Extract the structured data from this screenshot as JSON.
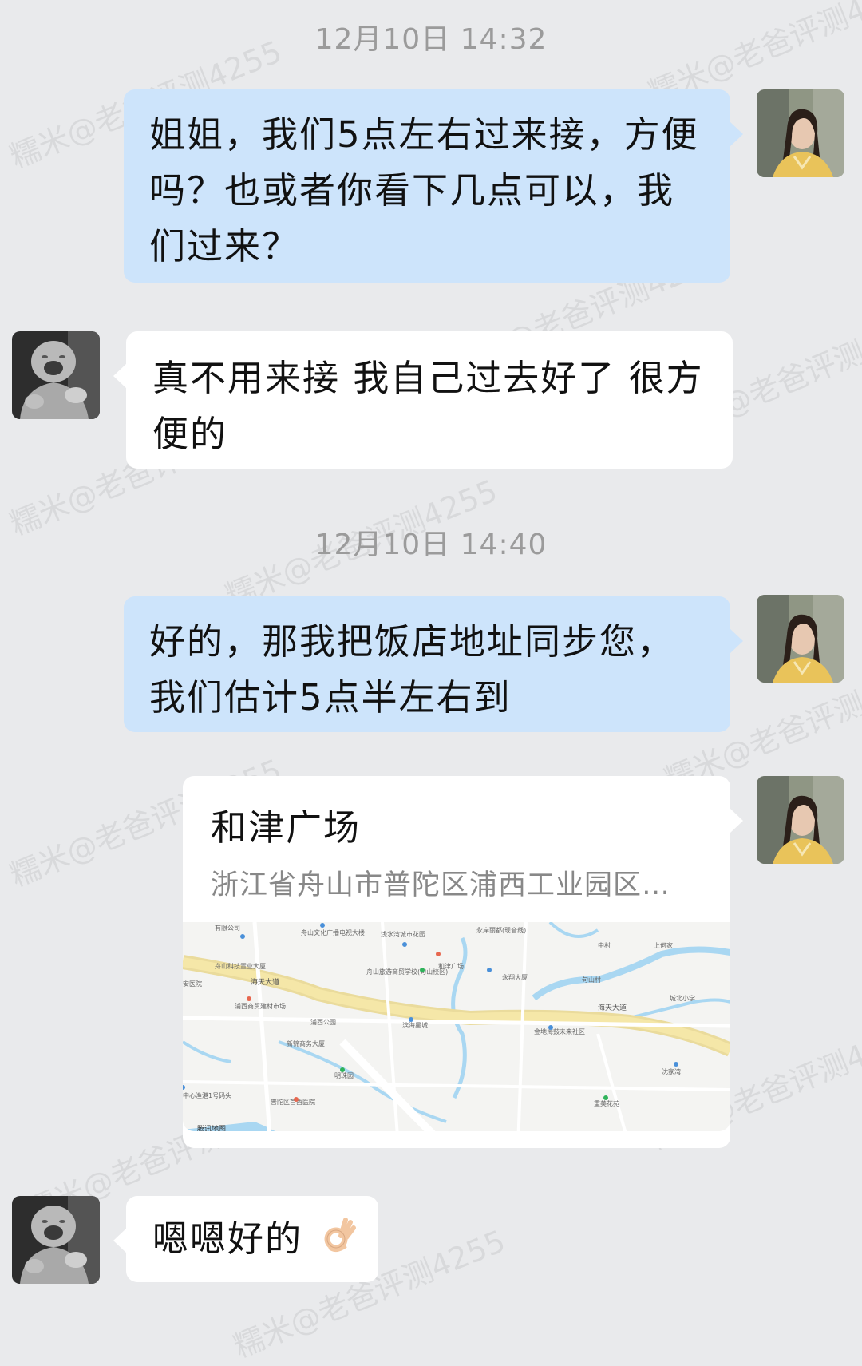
{
  "watermark": "糯米@老爸评测4255",
  "messages": {
    "ts1": "12月10日  14:32",
    "m1": "姐姐，我们5点左右过来接，方便吗？也或者你看下几点可以，我们过来？",
    "m2": "真不用来接 我自己过去好了 很方便的",
    "ts2": "12月10日  14:40",
    "m3": "好的，那我把饭店地址同步您，我们估计5点半左右到",
    "m5": "嗯嗯好的"
  },
  "location": {
    "title": "和津广场",
    "address": "浙江省舟山市普陀区浦西工业园区…",
    "labels": {
      "l1": "有限公司",
      "l2": "舟山文化广播电视大楼",
      "l3": "浅水湾城市花园",
      "l4": "永岸丽都(现音线)",
      "l5": "舟山科技置业大厦",
      "l6": "海天大道",
      "l7": "舟山旅游商贸学校(句山校区)",
      "l8": "和津广场",
      "l9": "永翔大厦",
      "l10": "句山村",
      "l11": "城北小学",
      "l12": "浦西商贸建材市场",
      "l13": "浦西公园",
      "l14": "滨海星城",
      "l15": "海天大道",
      "l16": "新锦商务大厦",
      "l17": "金地海鼓未来社区",
      "l18": "沈家湾",
      "l19": "明珠园",
      "l20": "中心渔港1号码头",
      "l21": "普陀区首酉医院",
      "l22": "重美花苑",
      "l23": "腾讯地图",
      "l24": "安医院",
      "l25": "中村",
      "l26": "上何家"
    }
  },
  "colors": {
    "background": "#e9eaec",
    "my_bubble": "#cde4fb",
    "their_bubble": "#ffffff",
    "timestamp": "#9b9b9b"
  }
}
